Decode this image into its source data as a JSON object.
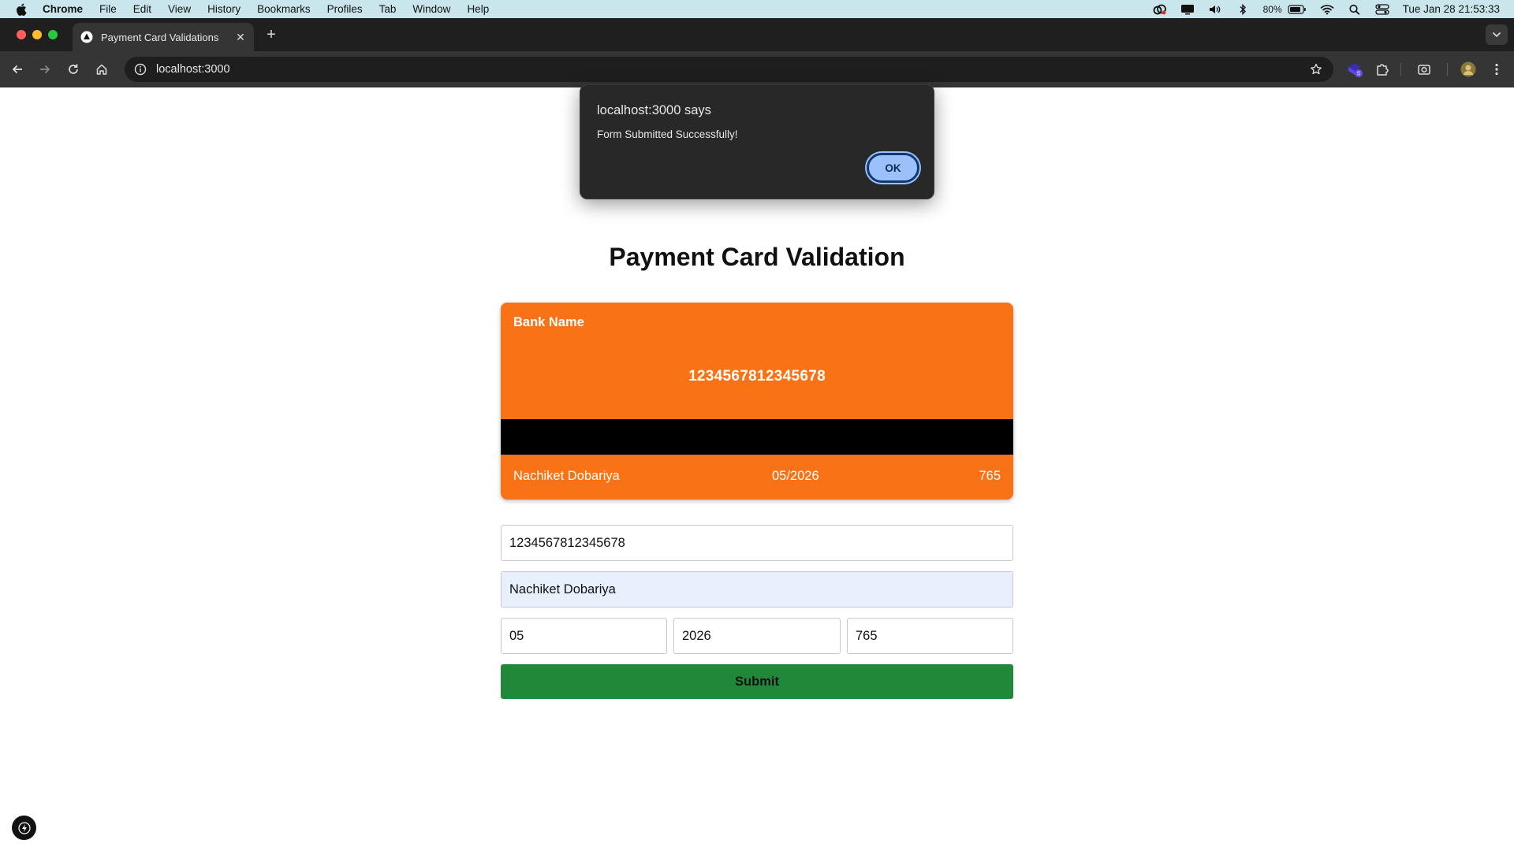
{
  "menubar": {
    "app_name": "Chrome",
    "items": [
      "File",
      "Edit",
      "View",
      "History",
      "Bookmarks",
      "Profiles",
      "Tab",
      "Window",
      "Help"
    ],
    "battery": "80%",
    "datetime": "Tue Jan 28  21:53:33",
    "status_icons": [
      "creative-cloud-icon",
      "display-icon",
      "volume-icon",
      "bluetooth-icon",
      "battery-icon",
      "wifi-icon",
      "spotlight-icon",
      "control-center-icon"
    ]
  },
  "browser": {
    "tab_title": "Payment Card Validations",
    "url": "localhost:3000",
    "extension_badge": "5"
  },
  "alert": {
    "title": "localhost:3000 says",
    "message": "Form Submitted Successfully!",
    "ok_label": "OK"
  },
  "page": {
    "title": "Payment Card Validation",
    "card": {
      "bank_name": "Bank Name",
      "number": "1234567812345678",
      "holder": "Nachiket Dobariya",
      "expiry": "05/2026",
      "cvv": "765",
      "color": "#f97316"
    },
    "form": {
      "card_number": "1234567812345678",
      "card_holder": "Nachiket Dobariya",
      "month": "05",
      "year": "2026",
      "cvv": "765",
      "submit_label": "Submit",
      "submit_color": "#21883a"
    }
  }
}
